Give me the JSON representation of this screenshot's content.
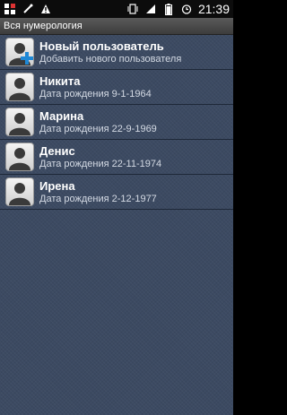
{
  "status_bar": {
    "time": "21:39",
    "icons": [
      "notification-icon",
      "usb-debug-icon",
      "warning-icon",
      "vibrate-icon",
      "signal-icon",
      "battery-icon",
      "alarm-icon"
    ]
  },
  "header": {
    "title": "Вся нумерология"
  },
  "list": {
    "items": [
      {
        "name": "Новый пользователь",
        "subtitle": "Добавить нового пользователя"
      },
      {
        "name": "Никита",
        "subtitle": "Дата рождения 9-1-1964"
      },
      {
        "name": "Марина",
        "subtitle": "Дата рождения 22-9-1969"
      },
      {
        "name": "Денис",
        "subtitle": "Дата рождения 22-11-1974"
      },
      {
        "name": "Ирена",
        "subtitle": "Дата рождения 2-12-1977"
      }
    ]
  },
  "colors": {
    "background": "#3c4a62",
    "text_primary": "#ffffff",
    "text_secondary": "#d4dae4",
    "add_plus": "#1e88d6"
  }
}
